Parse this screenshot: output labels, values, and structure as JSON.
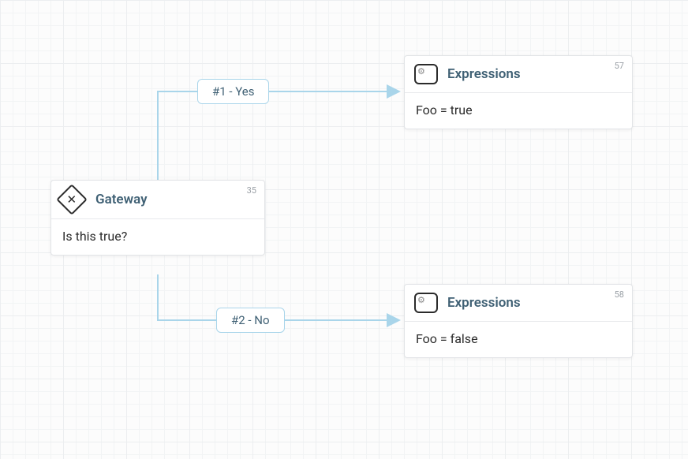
{
  "gateway": {
    "id": "35",
    "title": "Gateway",
    "body": "Is this true?"
  },
  "branches": {
    "yes": {
      "label": "#1 - Yes"
    },
    "no": {
      "label": "#2 - No"
    }
  },
  "expressions": {
    "first": {
      "id": "57",
      "title": "Expressions",
      "body": "Foo = true"
    },
    "second": {
      "id": "58",
      "title": "Expressions",
      "body": "Foo = false"
    }
  }
}
